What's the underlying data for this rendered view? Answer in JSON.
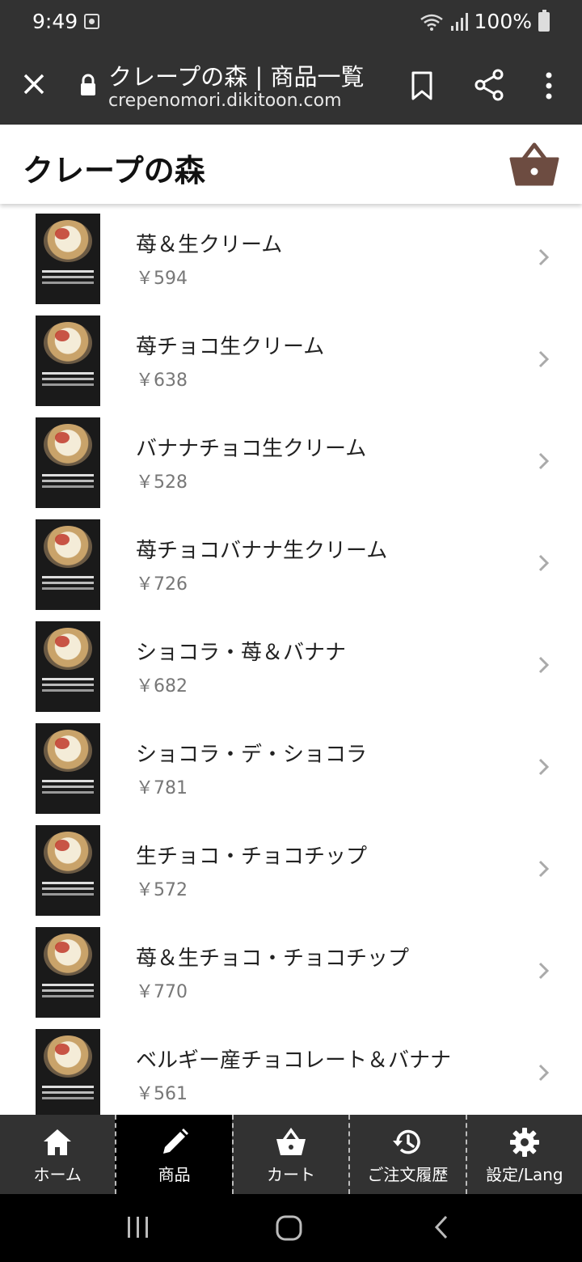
{
  "status_bar": {
    "time": "9:49",
    "battery": "100%"
  },
  "browser": {
    "title": "クレープの森 | 商品一覧",
    "url": "crepenomori.dikitoon.com"
  },
  "header": {
    "title": "クレープの森"
  },
  "products": [
    {
      "name": "苺＆生クリーム",
      "price": "￥594"
    },
    {
      "name": "苺チョコ生クリーム",
      "price": "￥638"
    },
    {
      "name": "バナナチョコ生クリーム",
      "price": "￥528"
    },
    {
      "name": "苺チョコバナナ生クリーム",
      "price": "￥726"
    },
    {
      "name": "ショコラ・苺＆バナナ",
      "price": "￥682"
    },
    {
      "name": "ショコラ・デ・ショコラ",
      "price": "￥781"
    },
    {
      "name": "生チョコ・チョコチップ",
      "price": "￥572"
    },
    {
      "name": "苺＆生チョコ・チョコチップ",
      "price": "￥770"
    },
    {
      "name": "ベルギー産チョコレート＆バナナ",
      "price": "￥561"
    }
  ],
  "nav": [
    {
      "label": "ホーム",
      "icon": "home-icon"
    },
    {
      "label": "商品",
      "icon": "pencil-icon",
      "active": true
    },
    {
      "label": "カート",
      "icon": "basket-icon"
    },
    {
      "label": "ご注文履歴",
      "icon": "history-icon"
    },
    {
      "label": "設定/Lang",
      "icon": "gear-icon"
    }
  ],
  "colors": {
    "accent": "#6d4c41",
    "bar": "#323232",
    "active_tab": "#000000"
  }
}
